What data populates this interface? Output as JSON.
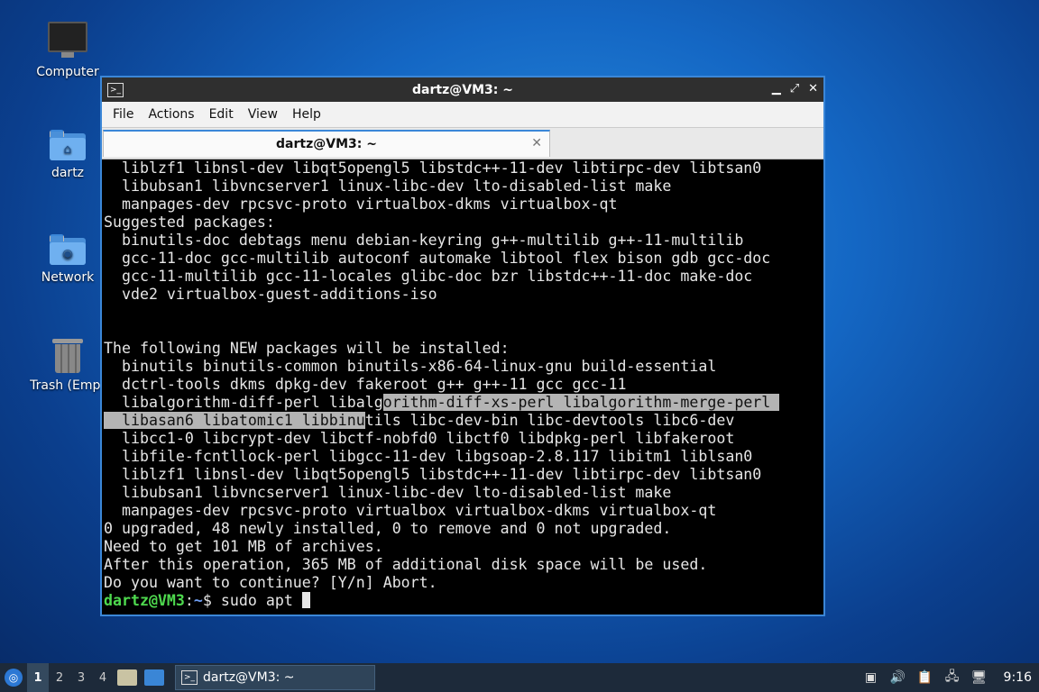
{
  "desktop": {
    "icons": [
      {
        "label": "Computer",
        "icon": "computer-icon"
      },
      {
        "label": "dartz",
        "icon": "home-folder-icon"
      },
      {
        "label": "Network",
        "icon": "network-folder-icon"
      },
      {
        "label": "Trash (Empt",
        "icon": "trash-icon"
      }
    ]
  },
  "window": {
    "title": "dartz@VM3: ~",
    "menu": [
      "File",
      "Actions",
      "Edit",
      "View",
      "Help"
    ],
    "tab_title": "dartz@VM3: ~",
    "controls": [
      "minimize",
      "maximize",
      "close"
    ]
  },
  "terminal": {
    "lines": [
      "  liblzf1 libnsl-dev libqt5opengl5 libstdc++-11-dev libtirpc-dev libtsan0",
      "  libubsan1 libvncserver1 linux-libc-dev lto-disabled-list make",
      "  manpages-dev rpcsvc-proto virtualbox-dkms virtualbox-qt",
      "Suggested packages:",
      "  binutils-doc debtags menu debian-keyring g++-multilib g++-11-multilib",
      "  gcc-11-doc gcc-multilib autoconf automake libtool flex bison gdb gcc-doc",
      "  gcc-11-multilib gcc-11-locales glibc-doc bzr libstdc++-11-doc make-doc",
      "  vde2 virtualbox-guest-additions-iso",
      "",
      "",
      "The following NEW packages will be installed:",
      "  binutils binutils-common binutils-x86-64-linux-gnu build-essential",
      "  dctrl-tools dkms dpkg-dev fakeroot g++ g++-11 gcc gcc-11"
    ],
    "sel_line1": {
      "pre": "  libalgorithm-diff-perl libalg",
      "sel": "orithm-diff-xs-perl libalgorithm-merge-perl ",
      "post": ""
    },
    "sel_line2": {
      "pre": "",
      "sel": "  libasan6 libatomic1 libbinu",
      "post": "tils libc-dev-bin libc-devtools libc6-dev"
    },
    "lines_after": [
      "  libcc1-0 libcrypt-dev libctf-nobfd0 libctf0 libdpkg-perl libfakeroot",
      "  libfile-fcntllock-perl libgcc-11-dev libgsoap-2.8.117 libitm1 liblsan0",
      "  liblzf1 libnsl-dev libqt5opengl5 libstdc++-11-dev libtirpc-dev libtsan0",
      "  libubsan1 libvncserver1 linux-libc-dev lto-disabled-list make",
      "  manpages-dev rpcsvc-proto virtualbox virtualbox-dkms virtualbox-qt",
      "0 upgraded, 48 newly installed, 0 to remove and 0 not upgraded.",
      "Need to get 101 MB of archives.",
      "After this operation, 365 MB of additional disk space will be used.",
      "Do you want to continue? [Y/n] Abort."
    ],
    "prompt": {
      "user": "dartz@VM3",
      "sep": ":",
      "path": "~",
      "sym": "$ ",
      "command": "sudo apt "
    }
  },
  "taskbar": {
    "workspaces": [
      "1",
      "2",
      "3",
      "4"
    ],
    "active_workspace": "1",
    "task_label": "dartz@VM3: ~",
    "clock": "9:16"
  }
}
